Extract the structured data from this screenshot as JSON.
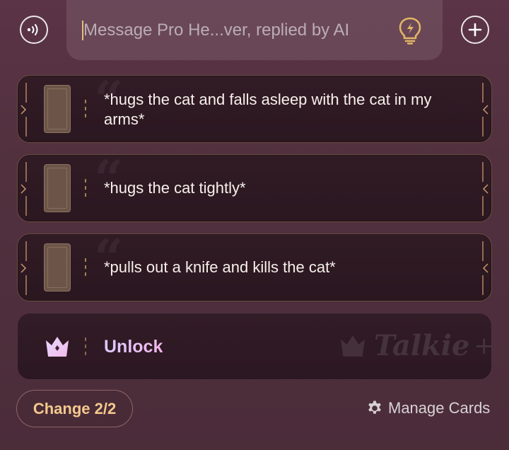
{
  "input": {
    "placeholder": "Message Pro He...ver, replied by AI"
  },
  "icons": {
    "voice": "voice-wave-icon",
    "bulb": "lightbulb-bolt-icon",
    "add": "plus-icon",
    "card": "tarot-card-icon",
    "crown": "crown-icon",
    "settings": "gear-icon"
  },
  "quotes": [
    {
      "text": "*hugs the cat and falls asleep with the cat in my arms*"
    },
    {
      "text": "*hugs the cat tightly*"
    },
    {
      "text": "*pulls out a knife and kills the cat*"
    }
  ],
  "unlock": {
    "label": "Unlock",
    "brand": "Talkie",
    "brand_suffix": "+"
  },
  "footer": {
    "change_label": "Change 2/2",
    "manage_label": "Manage Cards"
  },
  "colors": {
    "accent_gold": "#f3c98e",
    "unlock_gradient_start": "#d9c8ff",
    "unlock_gradient_end": "#f1b7e9",
    "background": "#53313f"
  }
}
